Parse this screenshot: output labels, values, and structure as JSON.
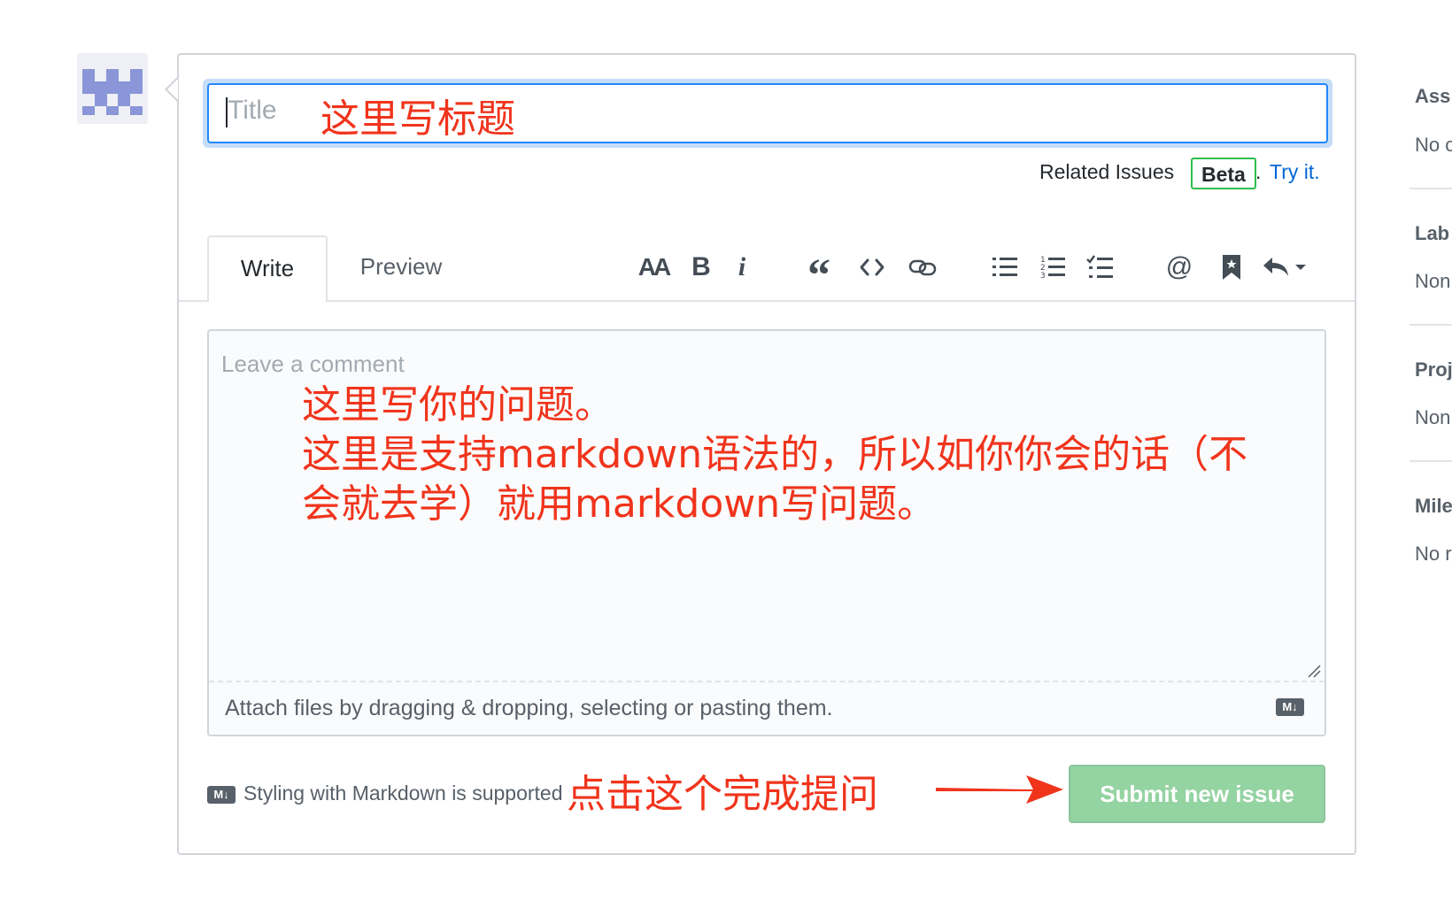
{
  "form": {
    "title_placeholder": "Title",
    "title_annotation": "这里写标题",
    "related_issues_label": "Related Issues",
    "beta_badge": "Beta",
    "period": ".",
    "try_it_link": "Try it.",
    "tabs": {
      "write": "Write",
      "preview": "Preview"
    },
    "toolbar": {
      "header": "AA",
      "bold": "B",
      "italic": "i",
      "quote": "“",
      "code": "<>",
      "mention": "@"
    },
    "comment_placeholder": "Leave a comment",
    "comment_annotation": [
      "这里写你的问题。",
      "这里是支持markdown语法的，所以如你你会的话（不",
      "会就去学）就用markdown写问题。"
    ],
    "attach_hint": "Attach files by dragging & dropping, selecting or pasting them.",
    "markdown_badge": "M↓",
    "styling_hint": "Styling with Markdown is supported",
    "submit_annotation": "点击这个完成提问",
    "submit_label": "Submit new issue"
  },
  "sidebar": {
    "sections": [
      {
        "heading": "Ass",
        "value": "No c"
      },
      {
        "heading": "Lab",
        "value": "Non"
      },
      {
        "heading": "Proj",
        "value": "Non"
      },
      {
        "heading": "Mile",
        "value": "No r"
      }
    ]
  },
  "colors": {
    "annotation": "#f0341c",
    "focus_blue": "#2188ff",
    "link_blue": "#0366d6",
    "beta_green": "#2cbe4e",
    "submit_disabled_green": "#94d3a2"
  },
  "icons": [
    "avatar-identicon",
    "quote-icon",
    "code-icon",
    "link-icon",
    "unordered-list-icon",
    "ordered-list-icon",
    "task-list-icon",
    "mention-icon",
    "bookmark-icon",
    "reply-icon",
    "chevron-down-icon",
    "markdown-icon",
    "arrow-icon"
  ]
}
